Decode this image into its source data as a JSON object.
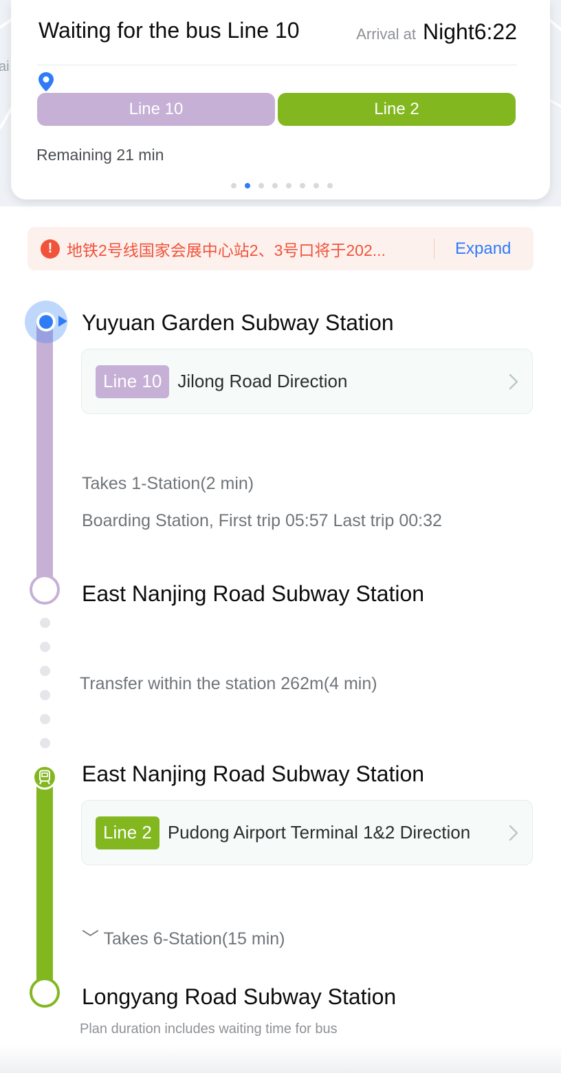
{
  "map": {
    "partial_label": "ai"
  },
  "header": {
    "title": "Waiting for the bus Line 10",
    "arrival_label": "Arrival at",
    "arrival_time": "Night6:22",
    "segments": [
      {
        "label": "Line 10",
        "color": "#c6b0d6"
      },
      {
        "label": "Line 2",
        "color": "#82b71f"
      }
    ],
    "remaining": "Remaining 21 min",
    "pager": {
      "total": 8,
      "active_index": 1
    }
  },
  "notice": {
    "text": "地铁2号线国家会展中心站2、3号口将于202...",
    "expand_label": "Expand"
  },
  "route": {
    "leg1": {
      "station": "Yuyuan Garden Subway Station",
      "line_badge": "Line 10",
      "line_color": "#c6b0d6",
      "direction": "Jilong Road Direction",
      "takes": "Takes 1-Station(2 min)",
      "schedule": "Boarding Station, First trip 05:57  Last trip 00:32"
    },
    "transfer": {
      "arrive_station": "East Nanjing Road Subway Station",
      "text": "Transfer within the station 262m(4 min)"
    },
    "leg2": {
      "station": "East Nanjing Road Subway Station",
      "line_badge": "Line 2",
      "line_color": "#82b71f",
      "direction": "Pudong Airport Terminal 1&2 Direction",
      "takes": "﹀ Takes 6-Station(15 min)"
    },
    "destination": "Longyang Road Subway Station",
    "footnote": "Plan duration includes waiting time for bus"
  },
  "icons": [
    "location-pin-icon",
    "alert-icon",
    "chevron-right-icon",
    "train-icon",
    "start-location-icon"
  ]
}
